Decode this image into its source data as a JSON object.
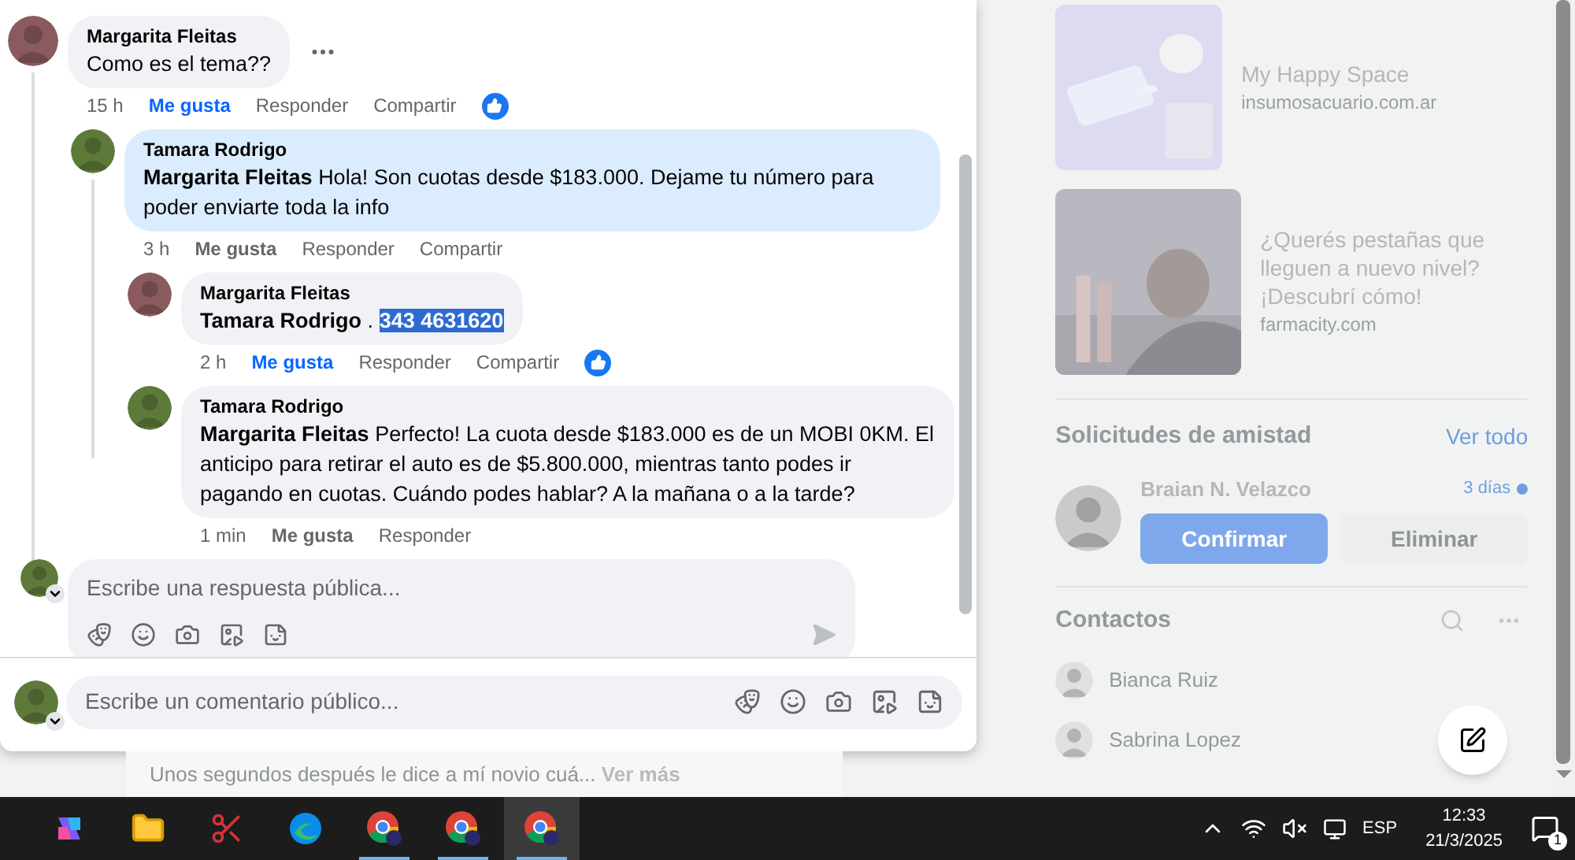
{
  "thread": {
    "author": "Margarita Fleitas",
    "text": "Como es el tema??",
    "time": "15 h",
    "like": "Me gusta",
    "liked": true,
    "reply": "Responder",
    "share": "Compartir",
    "reacted": true,
    "highlighted": false,
    "replies": [
      {
        "author": "Tamara Rodrigo",
        "mention": "Margarita Fleitas",
        "text": "Hola! Son cuotas desde $183.000. Dejame tu número para poder enviarte toda la info",
        "time": "3 h",
        "like": "Me gusta",
        "liked": false,
        "reply": "Responder",
        "share": "Compartir",
        "reacted": false,
        "highlighted": true,
        "replies": [
          {
            "author": "Margarita Fleitas",
            "mention": "Tamara Rodrigo",
            "text": ".",
            "selected_text": "343 4631620",
            "time": "2 h",
            "like": "Me gusta",
            "liked": true,
            "reply": "Responder",
            "share": "Compartir",
            "reacted": true,
            "highlighted": false
          },
          {
            "author": "Tamara Rodrigo",
            "mention": "Margarita Fleitas",
            "text": "Perfecto! La cuota desde $183.000 es de un MOBI 0KM. El anticipo para retirar el auto es de $5.800.000, mientras tanto podes ir pagando en cuotas. Cuándo podes hablar? A la mañana o a la tarde?",
            "time": "1 min",
            "like": "Me gusta",
            "liked": false,
            "reply": "Responder",
            "reacted": false,
            "highlighted": false
          }
        ]
      }
    ]
  },
  "reply_box": {
    "placeholder": "Escribe una respuesta pública..."
  },
  "comment_box": {
    "placeholder": "Escribe un comentario público..."
  },
  "background_post": {
    "text": "Unos segundos después  le dice a mí novio cuá...",
    "link": "Ver más"
  },
  "sidebar": {
    "ads": [
      {
        "title": "My Happy Space",
        "domain": "insumosacuario.com.ar"
      },
      {
        "title": "¿Querés pestañas que lleguen a nuevo nivel? ¡Descubrí cómo!",
        "domain": "farmacity.com"
      }
    ],
    "friend_requests": {
      "title": "Solicitudes de amistad",
      "see_all": "Ver todo",
      "items": [
        {
          "name": "Braian N. Velazco",
          "time": "3 días",
          "unread": true,
          "confirm": "Confirmar",
          "delete": "Eliminar"
        }
      ]
    },
    "contacts": {
      "title": "Contactos",
      "items": [
        {
          "name": "Bianca Ruiz"
        },
        {
          "name": "Sabrina Lopez"
        }
      ]
    }
  },
  "taskbar": {
    "apps": [
      {
        "kind": "copilot",
        "running": false,
        "selected": false
      },
      {
        "kind": "folder",
        "running": false,
        "selected": false
      },
      {
        "kind": "snip",
        "running": false,
        "selected": false
      },
      {
        "kind": "edge",
        "running": false,
        "selected": false
      },
      {
        "kind": "chrome",
        "running": true,
        "selected": false
      },
      {
        "kind": "chrome",
        "running": true,
        "selected": false
      },
      {
        "kind": "chrome",
        "running": true,
        "selected": true
      }
    ],
    "language": "ESP",
    "time": "12:33",
    "date": "21/3/2025",
    "notifications": "1"
  }
}
